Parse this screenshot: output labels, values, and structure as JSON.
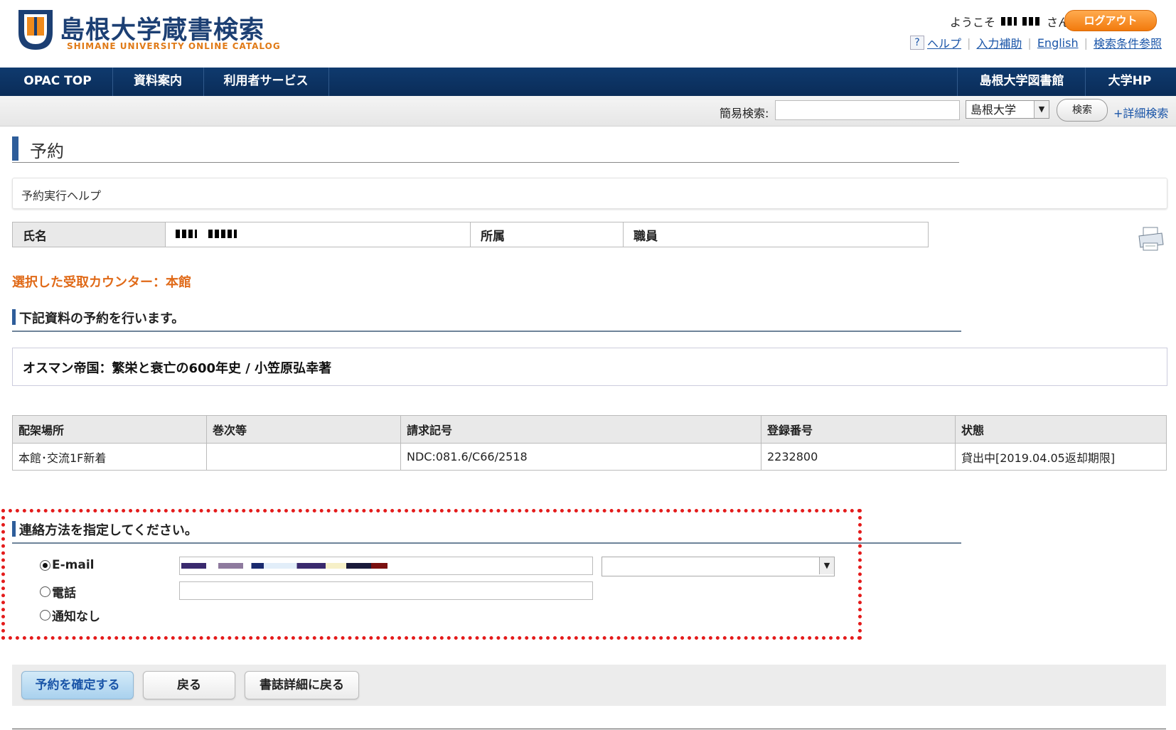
{
  "header": {
    "logo_title": "島根大学蔵書検索",
    "logo_subtitle": "SHIMANE UNIVERSITY ONLINE CATALOG",
    "welcome_prefix": "ようこそ",
    "welcome_suffix": "さん",
    "logout_label": "ログアウト",
    "help_icon_glyph": "?",
    "links": {
      "help": "ヘルプ",
      "input_assist": "入力補助",
      "english": "English",
      "search_reference": "検索条件参照"
    }
  },
  "nav": {
    "left": [
      "OPAC TOP",
      "資料案内",
      "利用者サービス"
    ],
    "right": [
      "島根大学図書館",
      "大学HP"
    ]
  },
  "search": {
    "label": "簡易検索:",
    "scope": "島根大学",
    "button": "検索",
    "advanced": "+詳細検索"
  },
  "page": {
    "title": "予約",
    "help_text": "予約実行ヘルプ"
  },
  "user": {
    "name_label": "氏名",
    "affiliation_label": "所属",
    "affiliation_value": "職員"
  },
  "counter_text": "選択した受取カウンター：本館",
  "reserve_section": {
    "heading": "下記資料の予約を行います。",
    "book_title": "オスマン帝国：繁栄と衰亡の600年史 / 小笠原弘幸著"
  },
  "items": {
    "headers": [
      "配架場所",
      "巻次等",
      "請求記号",
      "登録番号",
      "状態"
    ],
    "rows": [
      [
        "本館･交流1F新着",
        "",
        "NDC:081.6/C66/2518",
        "2232800",
        "貸出中[2019.04.05返却期限]"
      ]
    ]
  },
  "contact": {
    "heading": "連絡方法を指定してください。",
    "options": [
      "E-mail",
      "電話",
      "通知なし"
    ],
    "selected": "E-mail"
  },
  "buttons": {
    "confirm": "予約を確定する",
    "back": "戻る",
    "back_to_detail": "書誌詳細に戻る"
  },
  "colors": {
    "nav_bg": "#0f3a6e",
    "accent_orange": "#f27a0d",
    "link_blue": "#1a55a8",
    "highlight_red": "#e41b1b"
  }
}
